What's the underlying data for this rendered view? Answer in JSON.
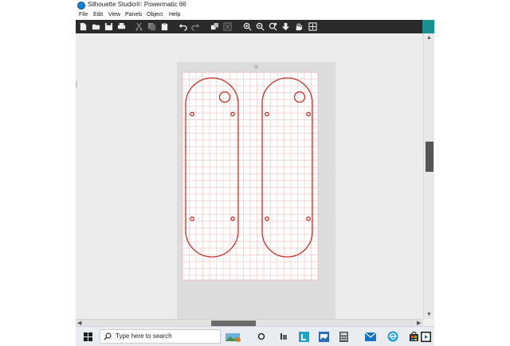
{
  "window": {
    "title": "Silhouette Studio®: Powermatic 66"
  },
  "menu": {
    "items": [
      "File",
      "Edit",
      "View",
      "Panels",
      "Object",
      "Help"
    ]
  },
  "toolbar": {
    "buttons": [
      "new-icon",
      "open-icon",
      "save-icon",
      "print-icon",
      "cut-icon",
      "copy-icon",
      "paste-icon",
      "undo-icon",
      "redo-icon",
      "group-icon",
      "ungroup-icon",
      "zoom-in-icon",
      "zoom-out-icon",
      "zoom-selection-icon",
      "move-down-icon",
      "pan-hand-icon",
      "fit-page-icon"
    ]
  },
  "taskbar": {
    "search_placeholder": "Type here to search",
    "apps": [
      "task-view-icon",
      "people-icon",
      "l-app-icon",
      "photos-icon",
      "calculator-icon",
      "mail-icon",
      "edge-icon",
      "store-icon",
      "media-player-icon"
    ]
  },
  "canvas": {
    "cut_line_color": "#c8302a",
    "grid_line_color": "#f2b6b6",
    "mat_color": "#dcdcdc"
  }
}
